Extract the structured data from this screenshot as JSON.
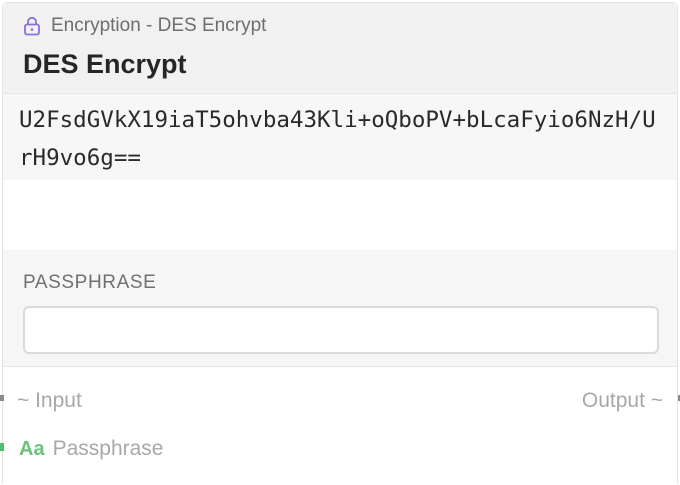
{
  "header": {
    "breadcrumb": "Encryption - DES Encrypt",
    "title": "DES Encrypt",
    "lock_icon": "lock-icon",
    "accent_color": "#8b6fd6"
  },
  "output": {
    "value": "U2FsdGVkX19iaT5ohvba43Kli+oQboPV+bLcaFyio6NzH/UrH9vo6g=="
  },
  "params": {
    "passphrase_label": "PASSPHRASE",
    "passphrase_value": ""
  },
  "io": {
    "input_label": "~ Input",
    "output_label": "Output ~",
    "passphrase_type_icon": "Aa",
    "passphrase_port_label": "Passphrase",
    "passphrase_color": "#6cc27a"
  }
}
